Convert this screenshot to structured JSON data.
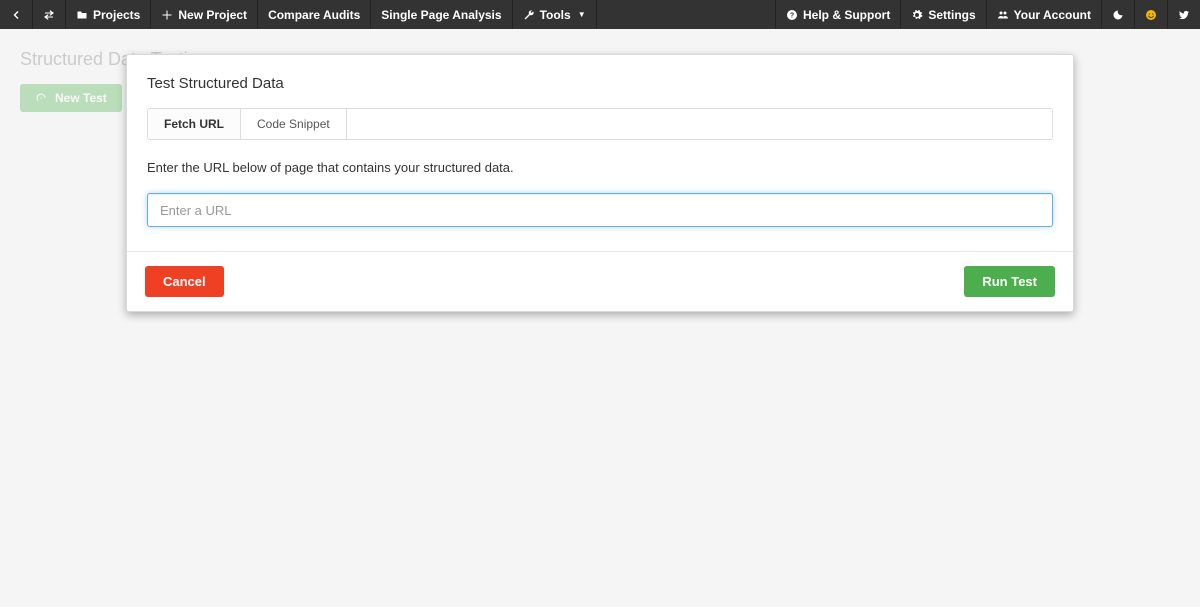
{
  "nav": {
    "projects": "Projects",
    "new_project": "New Project",
    "compare_audits": "Compare Audits",
    "single_page": "Single Page Analysis",
    "tools": "Tools",
    "help": "Help & Support",
    "settings": "Settings",
    "account": "Your Account"
  },
  "page": {
    "title": "Structured Data Testing",
    "new_test": "New Test"
  },
  "modal": {
    "title": "Test Structured Data",
    "tabs": {
      "fetch": "Fetch URL",
      "snippet": "Code Snippet"
    },
    "instruction": "Enter the URL below of page that contains your structured data.",
    "url_placeholder": "Enter a URL",
    "url_value": "",
    "cancel": "Cancel",
    "run": "Run Test"
  }
}
